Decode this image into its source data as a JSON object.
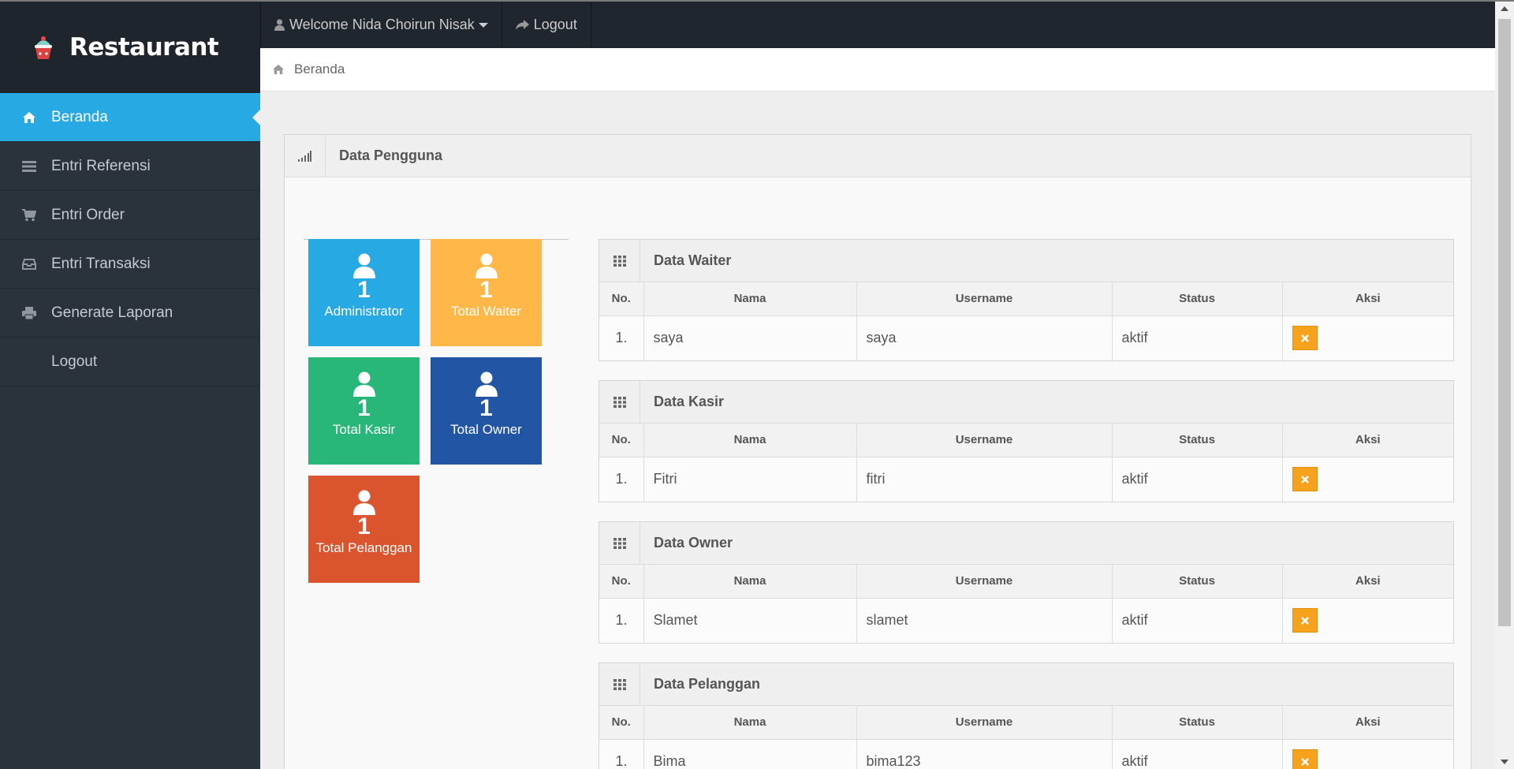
{
  "brand": {
    "name": "Restaurant",
    "icon": "cupcake-icon"
  },
  "navbar": {
    "welcome": "Welcome Nida Choirun Nisak",
    "logout": "Logout"
  },
  "sidebar": {
    "items": [
      {
        "label": "Beranda",
        "icon": "home-icon",
        "active": true
      },
      {
        "label": "Entri Referensi",
        "icon": "list-icon"
      },
      {
        "label": "Entri Order",
        "icon": "cart-icon"
      },
      {
        "label": "Entri Transaksi",
        "icon": "inbox-icon"
      },
      {
        "label": "Generate Laporan",
        "icon": "print-icon"
      },
      {
        "label": "Logout",
        "icon": ""
      }
    ]
  },
  "breadcrumb": {
    "label": "Beranda"
  },
  "panel": {
    "title": "Data Pengguna"
  },
  "tiles": [
    {
      "count": "1",
      "label": "Administrator",
      "color": "#27a9e3"
    },
    {
      "count": "1",
      "label": "Total Waiter",
      "color": "#ffb848"
    },
    {
      "count": "1",
      "label": "Total Kasir",
      "color": "#28b779"
    },
    {
      "count": "1",
      "label": "Total Owner",
      "color": "#2255a4"
    },
    {
      "count": "1",
      "label": "Total Pelanggan",
      "color": "#da542e"
    }
  ],
  "columns": {
    "no": "No.",
    "nama": "Nama",
    "username": "Username",
    "status": "Status",
    "aksi": "Aksi"
  },
  "tables": [
    {
      "title": "Data Waiter",
      "rows": [
        {
          "no": "1.",
          "nama": "saya",
          "username": "saya",
          "status": "aktif"
        }
      ]
    },
    {
      "title": "Data Kasir",
      "rows": [
        {
          "no": "1.",
          "nama": "Fitri",
          "username": "fitri",
          "status": "aktif"
        }
      ]
    },
    {
      "title": "Data Owner",
      "rows": [
        {
          "no": "1.",
          "nama": "Slamet",
          "username": "slamet",
          "status": "aktif"
        }
      ]
    },
    {
      "title": "Data Pelanggan",
      "rows": [
        {
          "no": "1.",
          "nama": "Bima",
          "username": "bima123",
          "status": "aktif"
        }
      ]
    }
  ],
  "colors": {
    "sidebar": "#2a323b",
    "active": "#27a9e3",
    "delete": "#f7a21d"
  }
}
